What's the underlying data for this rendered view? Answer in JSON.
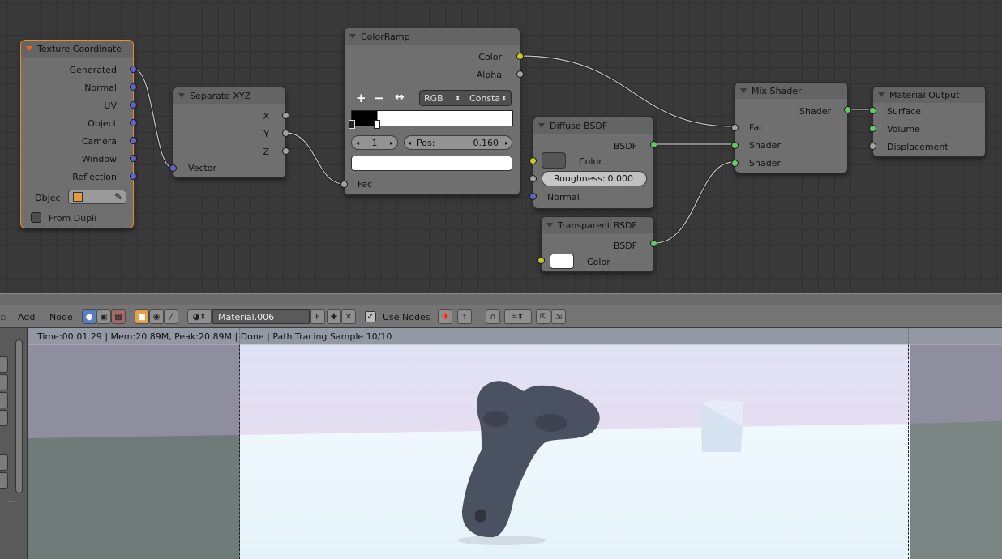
{
  "nodes": {
    "texture_coordinate": {
      "title": "Texture Coordinate",
      "outputs": [
        "Generated",
        "Normal",
        "UV",
        "Object",
        "Camera",
        "Window",
        "Reflection"
      ],
      "object_label": "Objec",
      "from_dupli_label": "From Dupli"
    },
    "separate_xyz": {
      "title": "Separate XYZ",
      "outputs": [
        "X",
        "Y",
        "Z"
      ],
      "input": "Vector"
    },
    "color_ramp": {
      "title": "ColorRamp",
      "outputs": [
        "Color",
        "Alpha"
      ],
      "add_symbol": "+",
      "remove_symbol": "−",
      "flip_symbol": "↔",
      "color_mode": "RGB",
      "interpolation": "Consta",
      "stop_index": "1",
      "pos_label": "Pos:",
      "pos_value": "0.160",
      "input": "Fac"
    },
    "diffuse_bsdf": {
      "title": "Diffuse BSDF",
      "output": "BSDF",
      "color_label": "Color",
      "roughness_label": "Roughness:",
      "roughness_value": "0.000",
      "normal_label": "Normal"
    },
    "transparent_bsdf": {
      "title": "Transparent BSDF",
      "output": "BSDF",
      "color_label": "Color"
    },
    "mix_shader": {
      "title": "Mix Shader",
      "output": "Shader",
      "inputs": [
        "Fac",
        "Shader",
        "Shader"
      ]
    },
    "material_output": {
      "title": "Material Output",
      "inputs": [
        "Surface",
        "Volume",
        "Displacement"
      ]
    }
  },
  "header": {
    "add_menu": "Add",
    "node_menu": "Node",
    "material_name": "Material.006",
    "fake_user": "F",
    "use_nodes_label": "Use Nodes",
    "use_nodes_checked": true
  },
  "viewport": {
    "status_text": "Time:00:01.29 | Mem:20.89M, Peak:20.89M | Done | Path Tracing Sample 10/10"
  },
  "colors": {
    "vector_socket": "#6363c7",
    "color_socket": "#c7c729",
    "float_socket": "#a1a1a1",
    "shader_socket": "#63c763",
    "active_node_border": "#f08a2a"
  }
}
